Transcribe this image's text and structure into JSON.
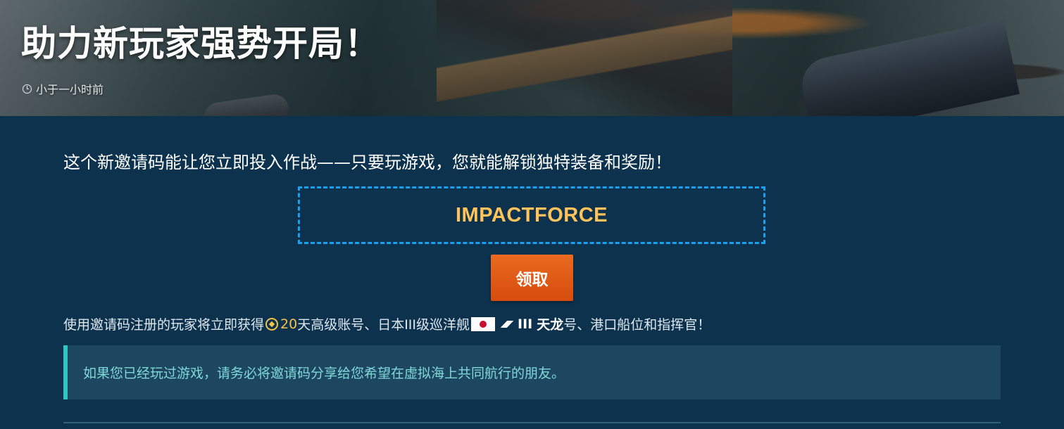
{
  "hero": {
    "title": "助力新玩家强势开局！",
    "time": "小于一小时前",
    "time_icon": "clock-icon"
  },
  "main": {
    "intro": "这个新邀请码能让您立即投入作战——只要玩游戏，您就能解锁独特装备和奖励！",
    "invite_code": "IMPACTFORCE",
    "claim_label": "领取",
    "reward": {
      "prefix": "使用邀请码注册的玩家将立即获得",
      "premium_icon": "premium-account-icon",
      "days": "20",
      "premium_text": "天高级账号、日本III级巡洋舰",
      "flag_icon": "japan-flag-icon",
      "class_icon": "cruiser-class-icon",
      "tier": "III",
      "ship_name": "天龙",
      "suffix": "号、港口船位和指挥官！"
    },
    "note": "如果您已经玩过游戏，请务必将邀请码分享给您希望在虚拟海上共同航行的朋友。"
  },
  "colors": {
    "background": "#0c324e",
    "accent_code": "#ffc35a",
    "dashed_border": "#1aa0f0",
    "button": "#d64c0e",
    "note_border": "#33c4c4",
    "note_text": "#7fd8d8"
  }
}
